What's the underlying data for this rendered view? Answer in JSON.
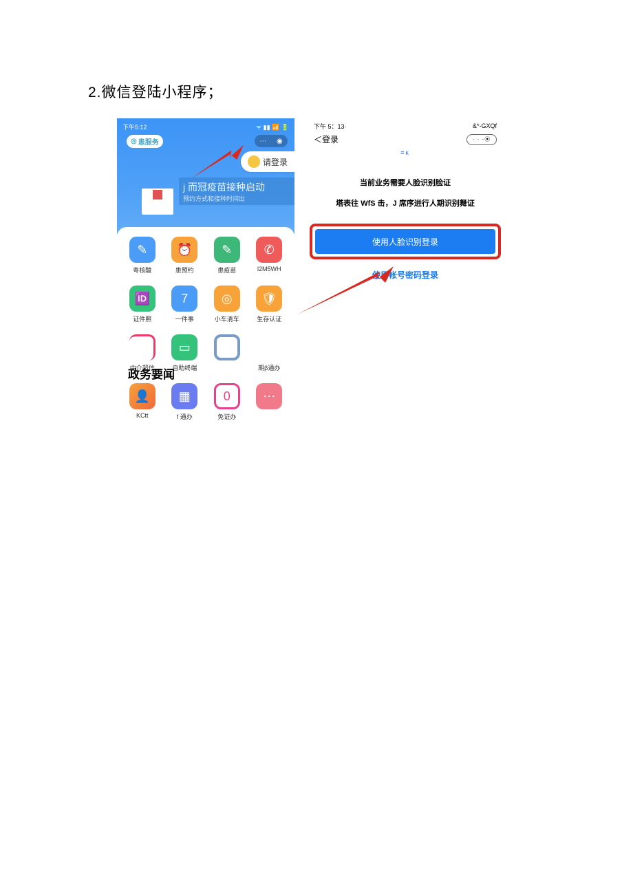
{
  "title": "2.微信登陆小程序；",
  "left": {
    "status_time": "下午5:12",
    "status_icons": "ᯤ ▮▮ 📶 🔋",
    "logo": "患服务",
    "capsule_dots": "··· ⦿",
    "login_label": "请登录",
    "banner_line1": "j 而冠疫苗接种启动",
    "banner_line2": "预约方式和接种时间出",
    "apps": {
      "r1": [
        {
          "label": "粤核酸",
          "icon": "✎"
        },
        {
          "label": "患预约",
          "icon": "⏰"
        },
        {
          "label": "患疫苗",
          "icon": "✎"
        },
        {
          "label": "l2M5WH",
          "icon": "✆"
        }
      ],
      "r2": [
        {
          "label": "证件照",
          "icon": "🆔"
        },
        {
          "label": "一件事",
          "icon": "7"
        },
        {
          "label": "小车清车",
          "icon": "◎"
        },
        {
          "label": "生存认证",
          "icon": "🛡"
        }
      ],
      "r3": [
        {
          "label": "中介超信",
          "icon": ""
        },
        {
          "label": "自助终端",
          "icon": "▭"
        },
        {
          "label": "",
          "icon": ""
        },
        {
          "label": "期β通办",
          "icon": ""
        }
      ],
      "r4": [
        {
          "label": "KCtt",
          "icon": "👤"
        },
        {
          "label": "f 通办",
          "icon": "▦"
        },
        {
          "label": "免证办",
          "icon": "0"
        },
        {
          "label": "",
          "icon": "⋯"
        }
      ]
    },
    "section": "政务要闻"
  },
  "right": {
    "status_time": "下午 5：13·",
    "status_right": "&*-GXQf",
    "back": "＜登录",
    "caps": "· · ·⦿",
    "mid": "≡ĸ",
    "msg1": "当前业务需要人脸识别脸证",
    "msg2": "塔表往 WfS 击，J 席序逬行人期识别舞证",
    "primary_btn": "使用人脸识别登录",
    "link": "使用帐号密码登录"
  }
}
